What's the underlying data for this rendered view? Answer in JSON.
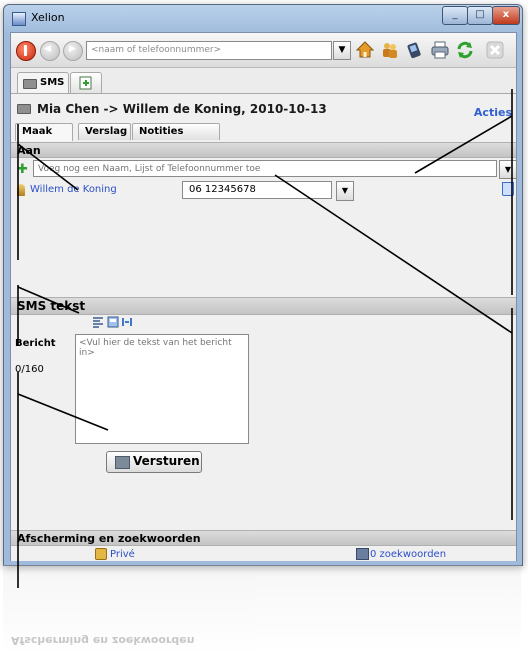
{
  "window": {
    "title": "Xelion",
    "min_label": "_",
    "max_label": "□",
    "close_label": "x"
  },
  "toolbar": {
    "search_placeholder": "<naam of telefoonnummer>",
    "icons": [
      "stop-icon",
      "back-icon",
      "forward-icon",
      "home-icon",
      "contacts-icon",
      "phone-icon",
      "print-icon",
      "refresh-icon",
      "close-icon"
    ]
  },
  "tabs": {
    "sms_label": "SMS"
  },
  "header": {
    "title": "Mia Chen -> Willem de Koning, 2010-10-13",
    "acties": "Acties"
  },
  "subtabs": {
    "maak": "Maak",
    "verslag": "Verslag",
    "notities": "Notities"
  },
  "aan": {
    "section_label": "Aan",
    "recipient_placeholder": "Voeg nog een Naam, Lijst of Telefoonnummer toe",
    "contact_name": "Willem de Koning",
    "phone_number": "06 12345678"
  },
  "sms": {
    "section_label": "SMS tekst",
    "bericht_label": "Bericht",
    "counter": "0/160",
    "message_placeholder": "<Vul hier de tekst van het bericht in>",
    "send_label": "Versturen"
  },
  "afscherming": {
    "section_label": "Afscherming en zoekwoorden",
    "prive": "Privé",
    "keywords": "0 zoekwoorden"
  },
  "colors": {
    "link": "#2c4fc8",
    "acties": "#2f5fd0",
    "call_red": "#d4251a",
    "warning": "#e5b400"
  }
}
